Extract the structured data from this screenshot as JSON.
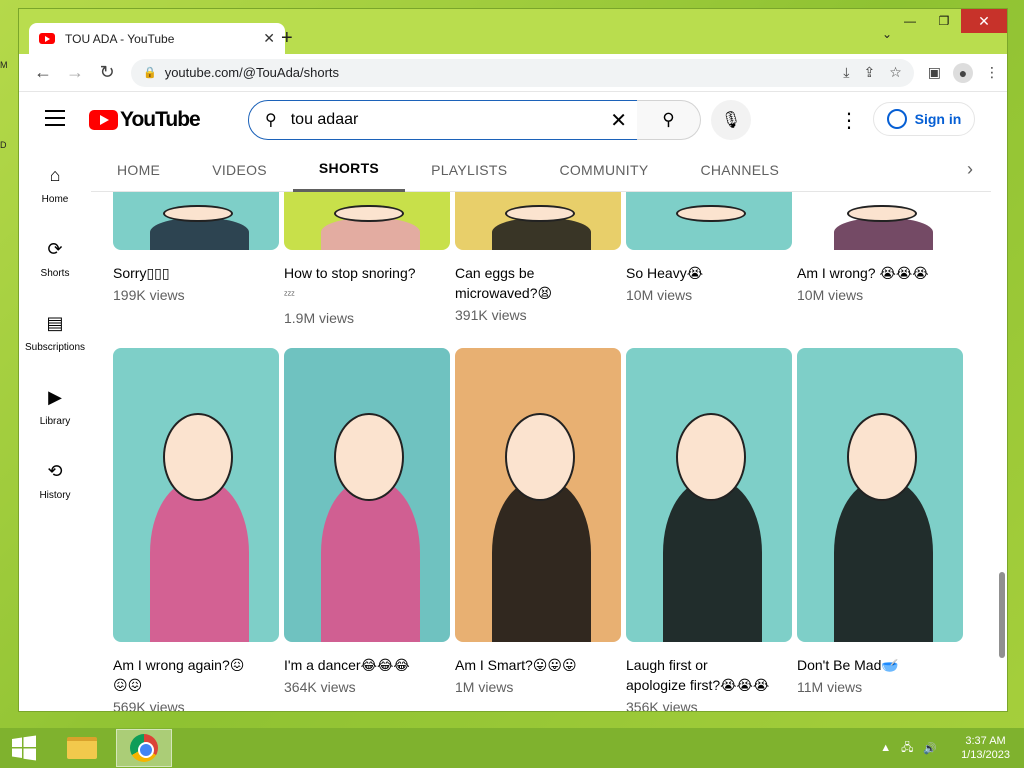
{
  "browser": {
    "tab_title": "TOU ADA - YouTube",
    "url": "youtube.com/@TouAda/shorts"
  },
  "youtube": {
    "logo_text": "YouTube",
    "search_value": "tou adaar",
    "sign_in_label": "Sign in"
  },
  "sidebar": {
    "items": [
      {
        "label": "Home",
        "icon": "home-icon"
      },
      {
        "label": "Shorts",
        "icon": "shorts-icon"
      },
      {
        "label": "Subscriptions",
        "icon": "subscriptions-icon"
      },
      {
        "label": "Library",
        "icon": "library-icon"
      },
      {
        "label": "History",
        "icon": "history-icon"
      }
    ]
  },
  "channel_tabs": [
    "HOME",
    "VIDEOS",
    "SHORTS",
    "PLAYLISTS",
    "COMMUNITY",
    "CHANNELS"
  ],
  "active_tab": "SHORTS",
  "shorts_row1": [
    {
      "title": "Sorry▯▯▯",
      "views": "199K views",
      "colors": [
        "#7ecfc8",
        "#1e2c3c"
      ]
    },
    {
      "title": "How to stop snoring?",
      "title2": "ᶻᶻᶻ",
      "views": "1.9M views",
      "colors": [
        "#c8e04a",
        "#e7a2b0"
      ]
    },
    {
      "title": "Can eggs be",
      "title2": "microwaved?😫",
      "views": "391K views",
      "colors": [
        "#e8cf6a",
        "#1a1a1a"
      ]
    },
    {
      "title": "So Heavy😭",
      "views": "10M views",
      "colors": [
        "#7ecfc8",
        "#7ecfc8"
      ]
    },
    {
      "title": "Am I wrong? 😭😭😭",
      "views": "10M views",
      "colors": [
        "#ffffff",
        "#5c2a4a"
      ]
    }
  ],
  "shorts_row2": [
    {
      "title": "Am I wrong again?😖",
      "title2": "😖😖",
      "views": "569K views",
      "colors": [
        "#7ecfc8",
        "#e24e8a"
      ]
    },
    {
      "title": "I'm a dancer😂😂😂",
      "views": "364K views",
      "colors": [
        "#6fc2c0",
        "#e24e8a"
      ]
    },
    {
      "title": "Am I Smart?😛😛😛",
      "views": "1M views",
      "colors": [
        "#e8b072",
        "#111111"
      ]
    },
    {
      "title": "Laugh first or",
      "title2": "apologize first?😭😭😭",
      "views": "356K views",
      "colors": [
        "#7ecfc8",
        "#111111"
      ]
    },
    {
      "title": "Don't Be Mad🥣",
      "views": "11M views",
      "colors": [
        "#7ecfc8",
        "#111111"
      ]
    }
  ],
  "taskbar": {
    "time": "3:37 AM",
    "date": "1/13/2023"
  }
}
